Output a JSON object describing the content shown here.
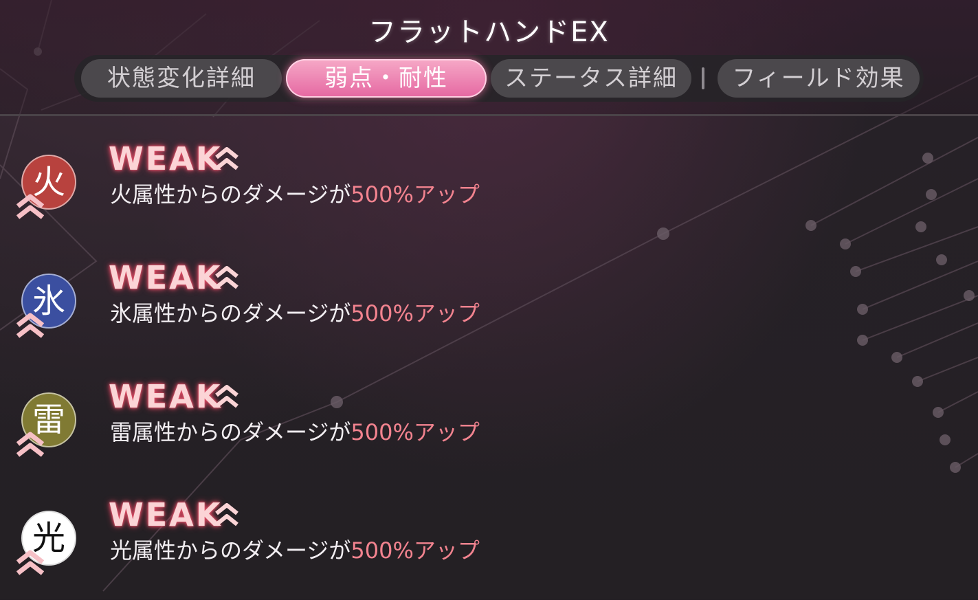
{
  "header": {
    "title": "フラットハンドEX"
  },
  "tabs": [
    {
      "label": "状態変化詳細",
      "active": false
    },
    {
      "label": "弱点・耐性",
      "active": true
    },
    {
      "label": "ステータス詳細",
      "active": false
    },
    {
      "label": "フィールド効果",
      "active": false
    }
  ],
  "entries": [
    {
      "element": "火",
      "icon_color": "#b8423e",
      "status": "WEAK",
      "text": "火属性からのダメージが",
      "amount": "500%アップ"
    },
    {
      "element": "氷",
      "icon_color": "#3b4fa0",
      "status": "WEAK",
      "text": "氷属性からのダメージが",
      "amount": "500%アップ"
    },
    {
      "element": "雷",
      "icon_color": "#807a33",
      "status": "WEAK",
      "text": "雷属性からのダメージが",
      "amount": "500%アップ"
    },
    {
      "element": "光",
      "icon_color": "#ffffff",
      "status": "WEAK",
      "text": "光属性からのダメージが",
      "amount": "500%アップ"
    }
  ],
  "colors": {
    "accent_pink": "#e567a1",
    "highlight_text": "#f2838f",
    "weak_glow": "#e05068"
  },
  "icons": {
    "weak_marker": "double-chevron-up-icon"
  }
}
